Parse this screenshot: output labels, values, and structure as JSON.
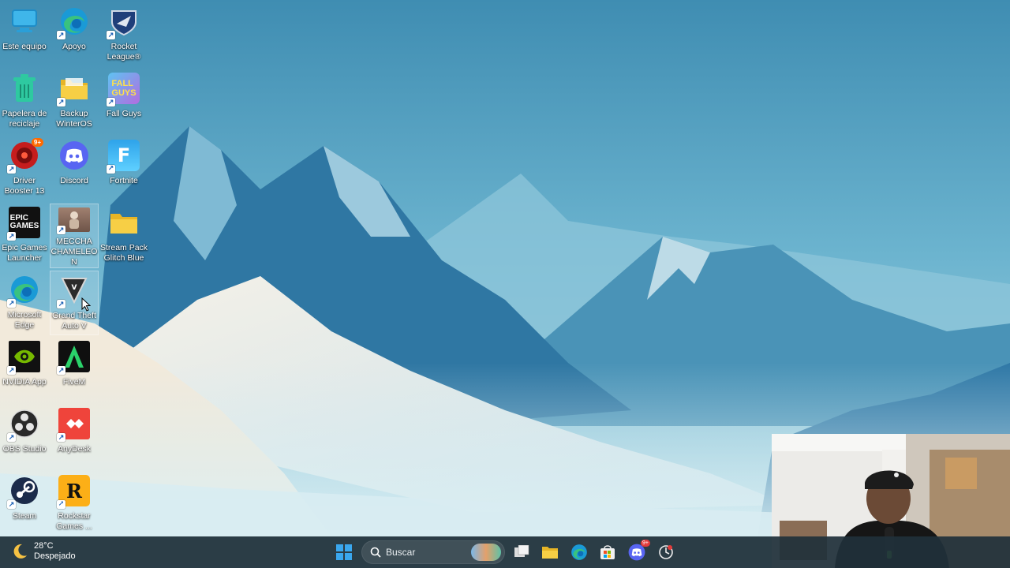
{
  "desktop": {
    "icons": [
      {
        "label": "Este equipo",
        "icon": "monitor-icon"
      },
      {
        "label": "Apoyo",
        "icon": "edge-icon"
      },
      {
        "label": "Rocket League®",
        "icon": "rocket-league-icon"
      },
      {
        "label": "Papelera de reciclaje",
        "icon": "recycle-bin-icon"
      },
      {
        "label": "Backup WinterOS",
        "icon": "folder-icon"
      },
      {
        "label": "Fall Guys",
        "icon": "fall-guys-icon"
      },
      {
        "label": "Driver Booster 13",
        "icon": "driver-booster-icon"
      },
      {
        "label": "Discord",
        "icon": "discord-icon"
      },
      {
        "label": "Fortnite",
        "icon": "fortnite-icon"
      },
      {
        "label": "Epic Games Launcher",
        "icon": "epic-games-icon"
      },
      {
        "label": "MECCHA CHAMELEON",
        "icon": "meccha-chameleon-icon"
      },
      {
        "label": "Stream Pack Glitch Blue",
        "icon": "folder-icon"
      },
      {
        "label": "Microsoft Edge",
        "icon": "edge-icon"
      },
      {
        "label": "Grand Theft Auto V",
        "icon": "gta-v-icon"
      },
      {
        "label": "NVIDIA App",
        "icon": "nvidia-icon"
      },
      {
        "label": "FiveM",
        "icon": "fivem-icon"
      },
      {
        "label": "OBS Studio",
        "icon": "obs-icon"
      },
      {
        "label": "AnyDesk",
        "icon": "anydesk-icon"
      },
      {
        "label": "Steam",
        "icon": "steam-icon"
      },
      {
        "label": "Rockstar Games ...",
        "icon": "rockstar-icon"
      }
    ],
    "badges": {
      "driver_booster": "9+"
    }
  },
  "taskbar": {
    "weather": {
      "temperature": "28°C",
      "condition": "Despejado",
      "icon": "moon-icon"
    },
    "search": {
      "placeholder": "Buscar"
    },
    "apps": [
      {
        "name": "start-button",
        "icon": "windows-icon"
      },
      {
        "name": "task-view",
        "icon": "task-view-icon"
      },
      {
        "name": "file-explorer",
        "icon": "folder-icon"
      },
      {
        "name": "edge",
        "icon": "edge-icon"
      },
      {
        "name": "microsoft-store",
        "icon": "store-icon"
      },
      {
        "name": "discord",
        "icon": "discord-icon",
        "badge": "9+"
      },
      {
        "name": "rockstar-launcher",
        "icon": "rockstar-icon"
      }
    ]
  },
  "colors": {
    "accent": "#1a7fd4",
    "taskbar": "#20303a",
    "discord": "#5865f2",
    "sky": "#5aa4c3"
  }
}
